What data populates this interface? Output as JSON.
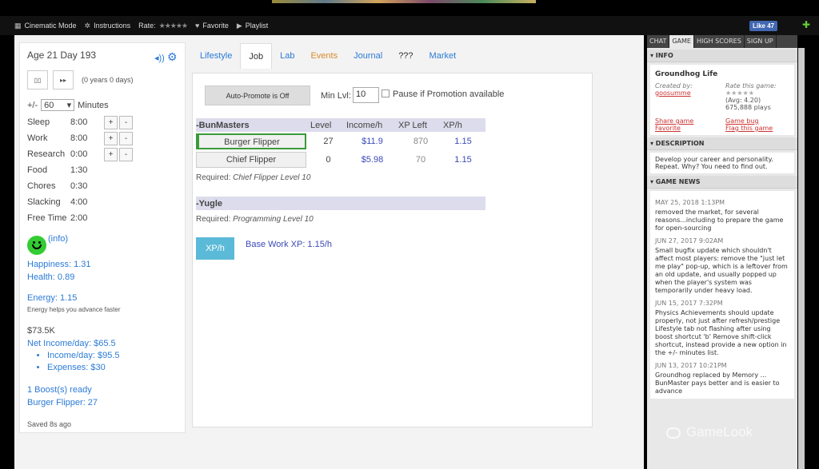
{
  "toolbar": {
    "cinematic": "Cinematic Mode",
    "instructions": "Instructions",
    "rate": "Rate:",
    "rate_stars": "★★★★★",
    "favorite": "Favorite",
    "playlist": "Playlist",
    "fb_like": "Like 47"
  },
  "left": {
    "age": "Age 21 Day 193",
    "years_days": "(0 years 0 days)",
    "plus_minus_label": "+/-",
    "plus_minus_value": "60",
    "minutes_label": "Minutes",
    "schedule": [
      {
        "k": "Sleep",
        "v": "8:00"
      },
      {
        "k": "Work",
        "v": "8:00"
      },
      {
        "k": "Research",
        "v": "0:00"
      },
      {
        "k": "Food",
        "v": "1:30"
      },
      {
        "k": "Chores",
        "v": "0:30"
      },
      {
        "k": "Slacking",
        "v": "4:00"
      },
      {
        "k": "Free Time",
        "v": "2:00"
      }
    ],
    "info_link": "(info)",
    "happiness": "Happiness: 1.31",
    "health": "Health: 0.89",
    "energy": "Energy: 1.15",
    "energy_note": "Energy helps you advance faster",
    "money": "$73.5K",
    "net_income": "Net Income/day: $65.5",
    "income": "Income/day: $95.5",
    "expenses": "Expenses: $30",
    "boosts": "1 Boost(s) ready",
    "boost_job": "Burger Flipper: 27",
    "saved": "Saved 8s ago"
  },
  "tabs": [
    "Lifestyle",
    "Job",
    "Lab",
    "Events",
    "Journal",
    "???",
    "Market"
  ],
  "job": {
    "auto_promote": "Auto-Promote is Off",
    "min_lvl_label": "Min Lvl:",
    "min_lvl_value": "10",
    "pause_label": "Pause if Promotion available",
    "headers": {
      "company": "-BunMasters",
      "level": "Level",
      "income": "Income/h",
      "xp_left": "XP Left",
      "xph": "XP/h"
    },
    "rows": [
      {
        "name": "Burger Flipper",
        "level": "27",
        "income": "$11.9",
        "xp_left": "870",
        "xph": "1.15"
      },
      {
        "name": "Chief Flipper",
        "level": "0",
        "income": "$5.98",
        "xp_left": "70",
        "xph": "1.15"
      }
    ],
    "required_label": "Required:",
    "req1": "Chief Flipper Level 10",
    "company2": "-Yugle",
    "req2": "Programming Level 10",
    "xp_button": "XP/h",
    "base_xp": "Base Work XP: 1.15/h"
  },
  "side": {
    "tabs": [
      "CHAT",
      "GAME",
      "HIGH SCORES",
      "SIGN UP"
    ],
    "info_head": "▾ INFO",
    "game_title": "Groundhog Life",
    "created_by": "Created by:",
    "author": "goosumme",
    "rate_game": "Rate this game:",
    "avg": "(Avg: 4.20)",
    "plays": "675,888 plays",
    "share": "Share game",
    "bug": "Game bug",
    "favorite": "Favorite",
    "flag": "Flag this game",
    "desc_head": "▾ DESCRIPTION",
    "desc": "Develop your career and personality. Repeat. Why? You need to find out.",
    "news_head": "▾ GAME NEWS",
    "news": [
      {
        "date": "MAY 25, 2018 1:13PM",
        "body": "removed the market, for several reasons...including to prepare the game for open-sourcing"
      },
      {
        "date": "JUN 27, 2017 9:02AM",
        "body": "Small bugfix update which shouldn't affect most players: remove the \"just let me play\" pop-up, which is a leftover from an old update, and usually popped up when the player's system was temporarily under heavy load."
      },
      {
        "date": "JUN 15, 2017 7:32PM",
        "body": "Physics Achievements should update properly, not just after refresh/prestige Lifestyle tab not flashing after using boost shortcut 'b' Remove shift-click shortcut, instead provide a new option in the +/- minutes list."
      },
      {
        "date": "JUN 13, 2017 10:21PM",
        "body": "Groundhog replaced by Memory ... BunMaster pays better and is easier to advance"
      }
    ]
  },
  "watermark": "GameLook"
}
